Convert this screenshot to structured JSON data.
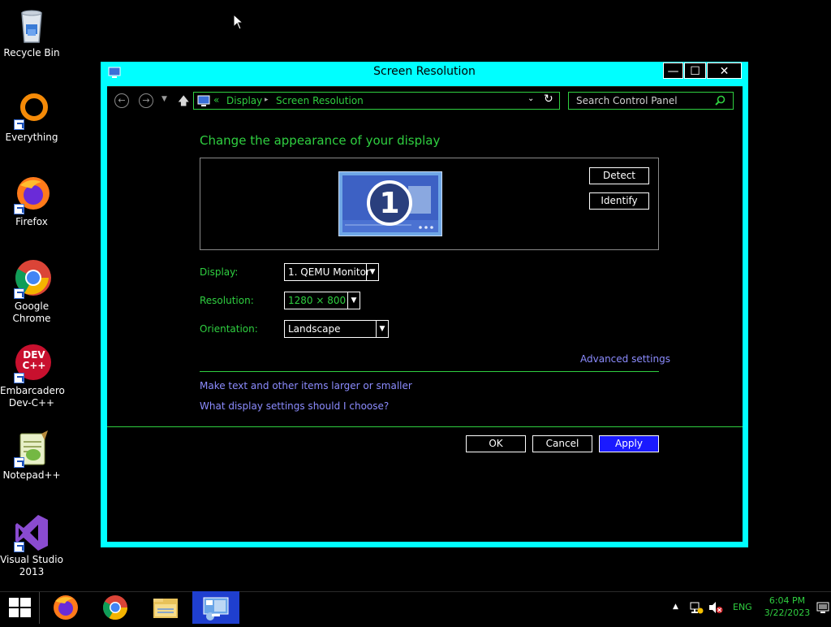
{
  "desktop": {
    "icons": [
      {
        "label": "Recycle Bin",
        "icon": "recycle-bin-icon"
      },
      {
        "label": "Everything",
        "icon": "everything-icon"
      },
      {
        "label": "Firefox",
        "icon": "firefox-icon"
      },
      {
        "label": "Google Chrome",
        "icon": "chrome-icon"
      },
      {
        "label": "Embarcadero Dev-C++",
        "icon": "devcpp-icon"
      },
      {
        "label": "Notepad++",
        "icon": "notepadpp-icon"
      },
      {
        "label": "Visual Studio 2013",
        "icon": "visual-studio-icon"
      }
    ],
    "devcpp_logo": "DEV C++"
  },
  "window": {
    "title": "Screen Resolution",
    "controls": {
      "minimize": "—",
      "maximize": "☐",
      "close": "✕"
    }
  },
  "address_bar": {
    "prefix": "«",
    "breadcrumb": [
      "Display",
      "Screen Resolution"
    ],
    "separator": "▸"
  },
  "search": {
    "placeholder": "Search Control Panel"
  },
  "main": {
    "heading": "Change the appearance of your display",
    "monitor_number": "1",
    "detect_label": "Detect",
    "identify_label": "Identify",
    "display_label": "Display:",
    "display_value": "1. QEMU Monitor",
    "resolution_label": "Resolution:",
    "resolution_value": "1280 × 800",
    "orientation_label": "Orientation:",
    "orientation_value": "Landscape",
    "advanced_settings": "Advanced settings",
    "link_text_size": "Make text and other items larger or smaller",
    "link_what_settings": "What display settings should I choose?"
  },
  "buttons": {
    "ok": "OK",
    "cancel": "Cancel",
    "apply": "Apply"
  },
  "taskbar": {
    "apps": [
      "windows-start-icon",
      "firefox-icon",
      "chrome-icon",
      "file-explorer-icon",
      "control-panel-icon"
    ],
    "tray": {
      "language": "ENG",
      "time": "6:04 PM",
      "date": "3/22/2023"
    }
  },
  "colors": {
    "window_frame": "#00ffff",
    "accent_green": "#2fcf40",
    "link_blue": "#8c8cff",
    "apply_blue": "#1a1aff"
  }
}
